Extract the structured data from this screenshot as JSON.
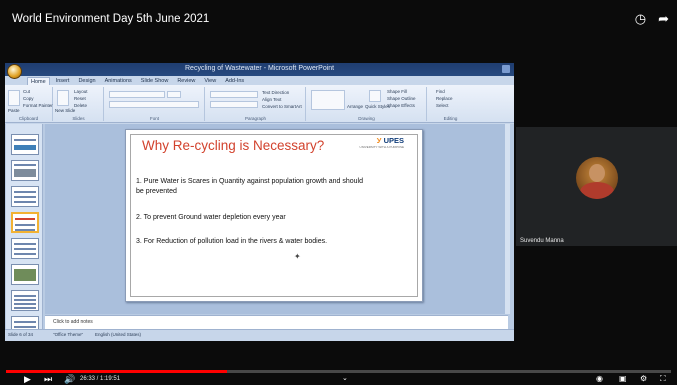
{
  "video": {
    "title": "World Environment Day 5th June 2021",
    "clock_icon": "clock-icon",
    "share_icon": "share-icon"
  },
  "ppt": {
    "doc_title": "Recycling of Wastewater - Microsoft PowerPoint",
    "tabs": [
      "Home",
      "Insert",
      "Design",
      "Animations",
      "Slide Show",
      "Review",
      "View",
      "Add-Ins"
    ],
    "ribbon_groups": [
      "Clipboard",
      "Slides",
      "Font",
      "Paragraph",
      "Drawing",
      "Editing"
    ],
    "ribbon_buttons": [
      "Cut",
      "Copy",
      "Paste",
      "Format Painter",
      "New Slide",
      "Layout",
      "Reset",
      "Delete",
      "Text Direction",
      "Align Text",
      "Convert to SmartArt",
      "Arrange",
      "Quick Styles",
      "Shape Fill",
      "Shape Outline",
      "Shape Effects",
      "Find",
      "Replace",
      "Select"
    ],
    "notes_placeholder": "Click to add notes",
    "status": {
      "slide_info": "Slide 6 of 34",
      "theme": "\"Office Theme\"",
      "language": "English (United States)"
    }
  },
  "slide": {
    "title": "Why Re-cycling is Necessary?",
    "logo": "UPES",
    "logo_sub": "UNIVERSITY WITH A PURPOSE",
    "items": [
      "1. Pure Water is Scares in Quantity against population growth and should be prevented",
      "2. To prevent Ground water depletion every year",
      "3. For Reduction of pollution load in the rivers & water bodies."
    ]
  },
  "participant": {
    "name": "Suvendu Manna"
  },
  "player": {
    "time": "26:33 / 1:19:51",
    "progress": 0.333
  }
}
